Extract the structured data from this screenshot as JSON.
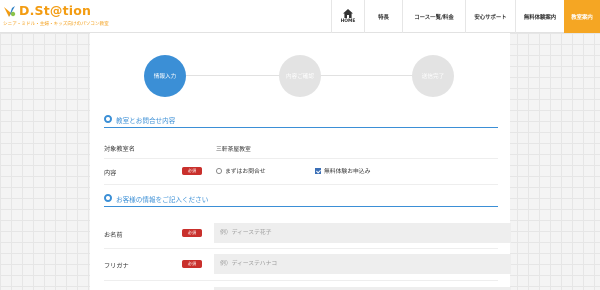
{
  "header": {
    "logo_text": "D.St@tion",
    "logo_sub": "シニア・ミドル・主婦・キッズ向けのパソコン教室",
    "nav": [
      {
        "label": "HOME",
        "icon": "home-icon"
      },
      {
        "label": "特長"
      },
      {
        "label": "コース一覧/料金"
      },
      {
        "label": "安心サポート"
      },
      {
        "label": "無料体験案内"
      },
      {
        "label": "教室案内",
        "active": true
      }
    ],
    "accent_color": "#f5a623"
  },
  "steps": [
    {
      "label": "情報入力",
      "active": true
    },
    {
      "label": "内容ご確認",
      "active": false
    },
    {
      "label": "送信完了",
      "active": false
    }
  ],
  "section1": {
    "title": "教室とお問合せ内容",
    "school_label": "対象教室名",
    "school_value": "三軒茶屋教室",
    "content_label": "内容",
    "content_badge": "必須",
    "option_inquiry": "まずはお問合せ",
    "option_trial": "無料体験お申込み"
  },
  "section2": {
    "title": "お客様の情報をご記入ください",
    "name_label": "お名前",
    "name_badge": "必須",
    "name_placeholder": "例）ディーステ花子",
    "kana_label": "フリガナ",
    "kana_badge": "必須",
    "kana_placeholder": "例）ディーステハナコ"
  },
  "colors": {
    "primary_blue": "#3b8fd6",
    "required_red": "#c9302c",
    "logo_orange": "#f39c12"
  }
}
